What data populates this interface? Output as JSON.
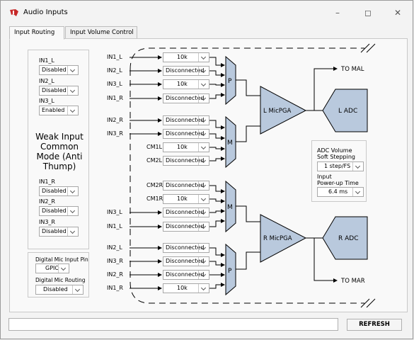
{
  "window": {
    "title": "Audio Inputs"
  },
  "tabs": [
    "Input Routing",
    "Input Volume Control"
  ],
  "left_panel": {
    "groups_top": [
      {
        "label": "IN1_L",
        "value": "Disabled"
      },
      {
        "label": "IN2_L",
        "value": "Disabled"
      },
      {
        "label": "IN3_L",
        "value": "Enabled"
      }
    ],
    "weak_input": "Weak Input Common Mode (Anti Thump)",
    "groups_bottom": [
      {
        "label": "IN1_R",
        "value": "Disabled"
      },
      {
        "label": "IN2_R",
        "value": "Disabled"
      },
      {
        "label": "IN3_R",
        "value": "Disabled"
      }
    ],
    "digital_mic_pin": {
      "label": "Digital Mic Input Pin",
      "value": "GPIO"
    },
    "digital_mic_routing": {
      "label": "Digital Mic Routing",
      "value": "Disabled"
    }
  },
  "routing": {
    "left_P": [
      {
        "pin": "IN1_L",
        "value": "10k"
      },
      {
        "pin": "IN2_L",
        "value": "Disconnected"
      },
      {
        "pin": "IN3_L",
        "value": "10k"
      },
      {
        "pin": "IN1_R",
        "value": "Disconnected"
      }
    ],
    "left_M": [
      {
        "pin": "IN2_R",
        "value": "Disconnected"
      },
      {
        "pin": "IN3_R",
        "value": "Disconnected"
      },
      {
        "pin": "CM1L",
        "value": "10k"
      },
      {
        "pin": "CM2L",
        "value": "Disconnected"
      }
    ],
    "right_M": [
      {
        "pin": "CM2R",
        "value": "Disconnected"
      },
      {
        "pin": "CM1R",
        "value": "10k"
      },
      {
        "pin": "IN3_L",
        "value": "Disconnected"
      },
      {
        "pin": "IN1_L",
        "value": "Disconnected"
      }
    ],
    "right_P": [
      {
        "pin": "IN2_L",
        "value": "Disconnected"
      },
      {
        "pin": "IN3_R",
        "value": "Disconnected"
      },
      {
        "pin": "IN2_R",
        "value": "Disconnected"
      },
      {
        "pin": "IN1_R",
        "value": "10k"
      }
    ]
  },
  "mux_labels": {
    "p": "P",
    "m": "M"
  },
  "pga": {
    "left": "L MicPGA",
    "right": "R MicPGA"
  },
  "adc": {
    "left": "L ADC",
    "right": "R ADC"
  },
  "outputs": {
    "to_mal": "TO MAL",
    "to_mar": "TO MAR"
  },
  "adc_settings": {
    "volume_label_1": "ADC Volume",
    "volume_label_2": "Soft Stepping",
    "volume_value": "1 step/FS",
    "powerup_label_1": "Input",
    "powerup_label_2": "Power-up Time",
    "powerup_value": "6.4 ms"
  },
  "status_text": "",
  "refresh_label": "REFRESH"
}
